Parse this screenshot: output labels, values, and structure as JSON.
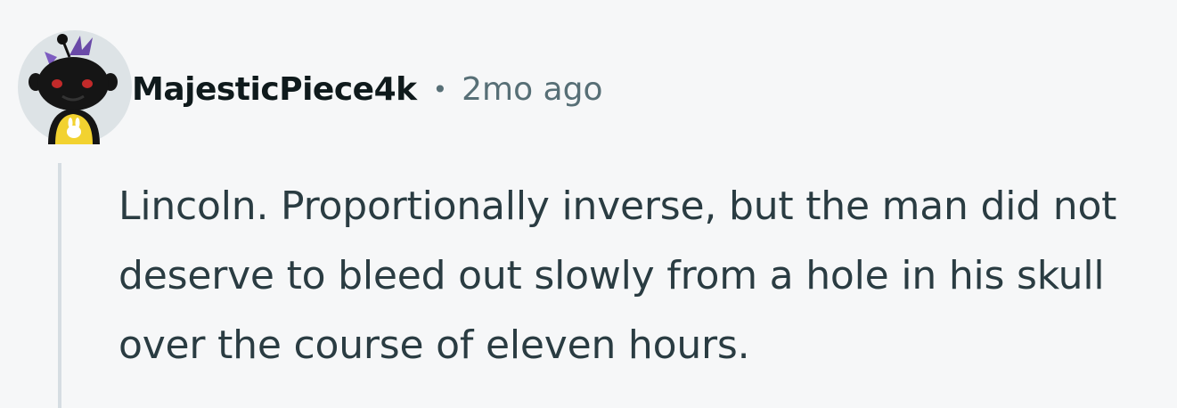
{
  "comment": {
    "author": "MajesticPiece4k",
    "separator": "•",
    "timestamp": "2mo ago",
    "body": "Lincoln. Proportionally inverse, but the man did not deserve to bleed out slowly from a hole in his skull over the course of eleven hours.",
    "avatar_icon": "snoo-avatar-icon"
  },
  "colors": {
    "background": "#f6f7f8",
    "author": "#0f1a1c",
    "meta": "#576f76",
    "body": "#2a3c42",
    "thread_line": "#d6dde2"
  }
}
